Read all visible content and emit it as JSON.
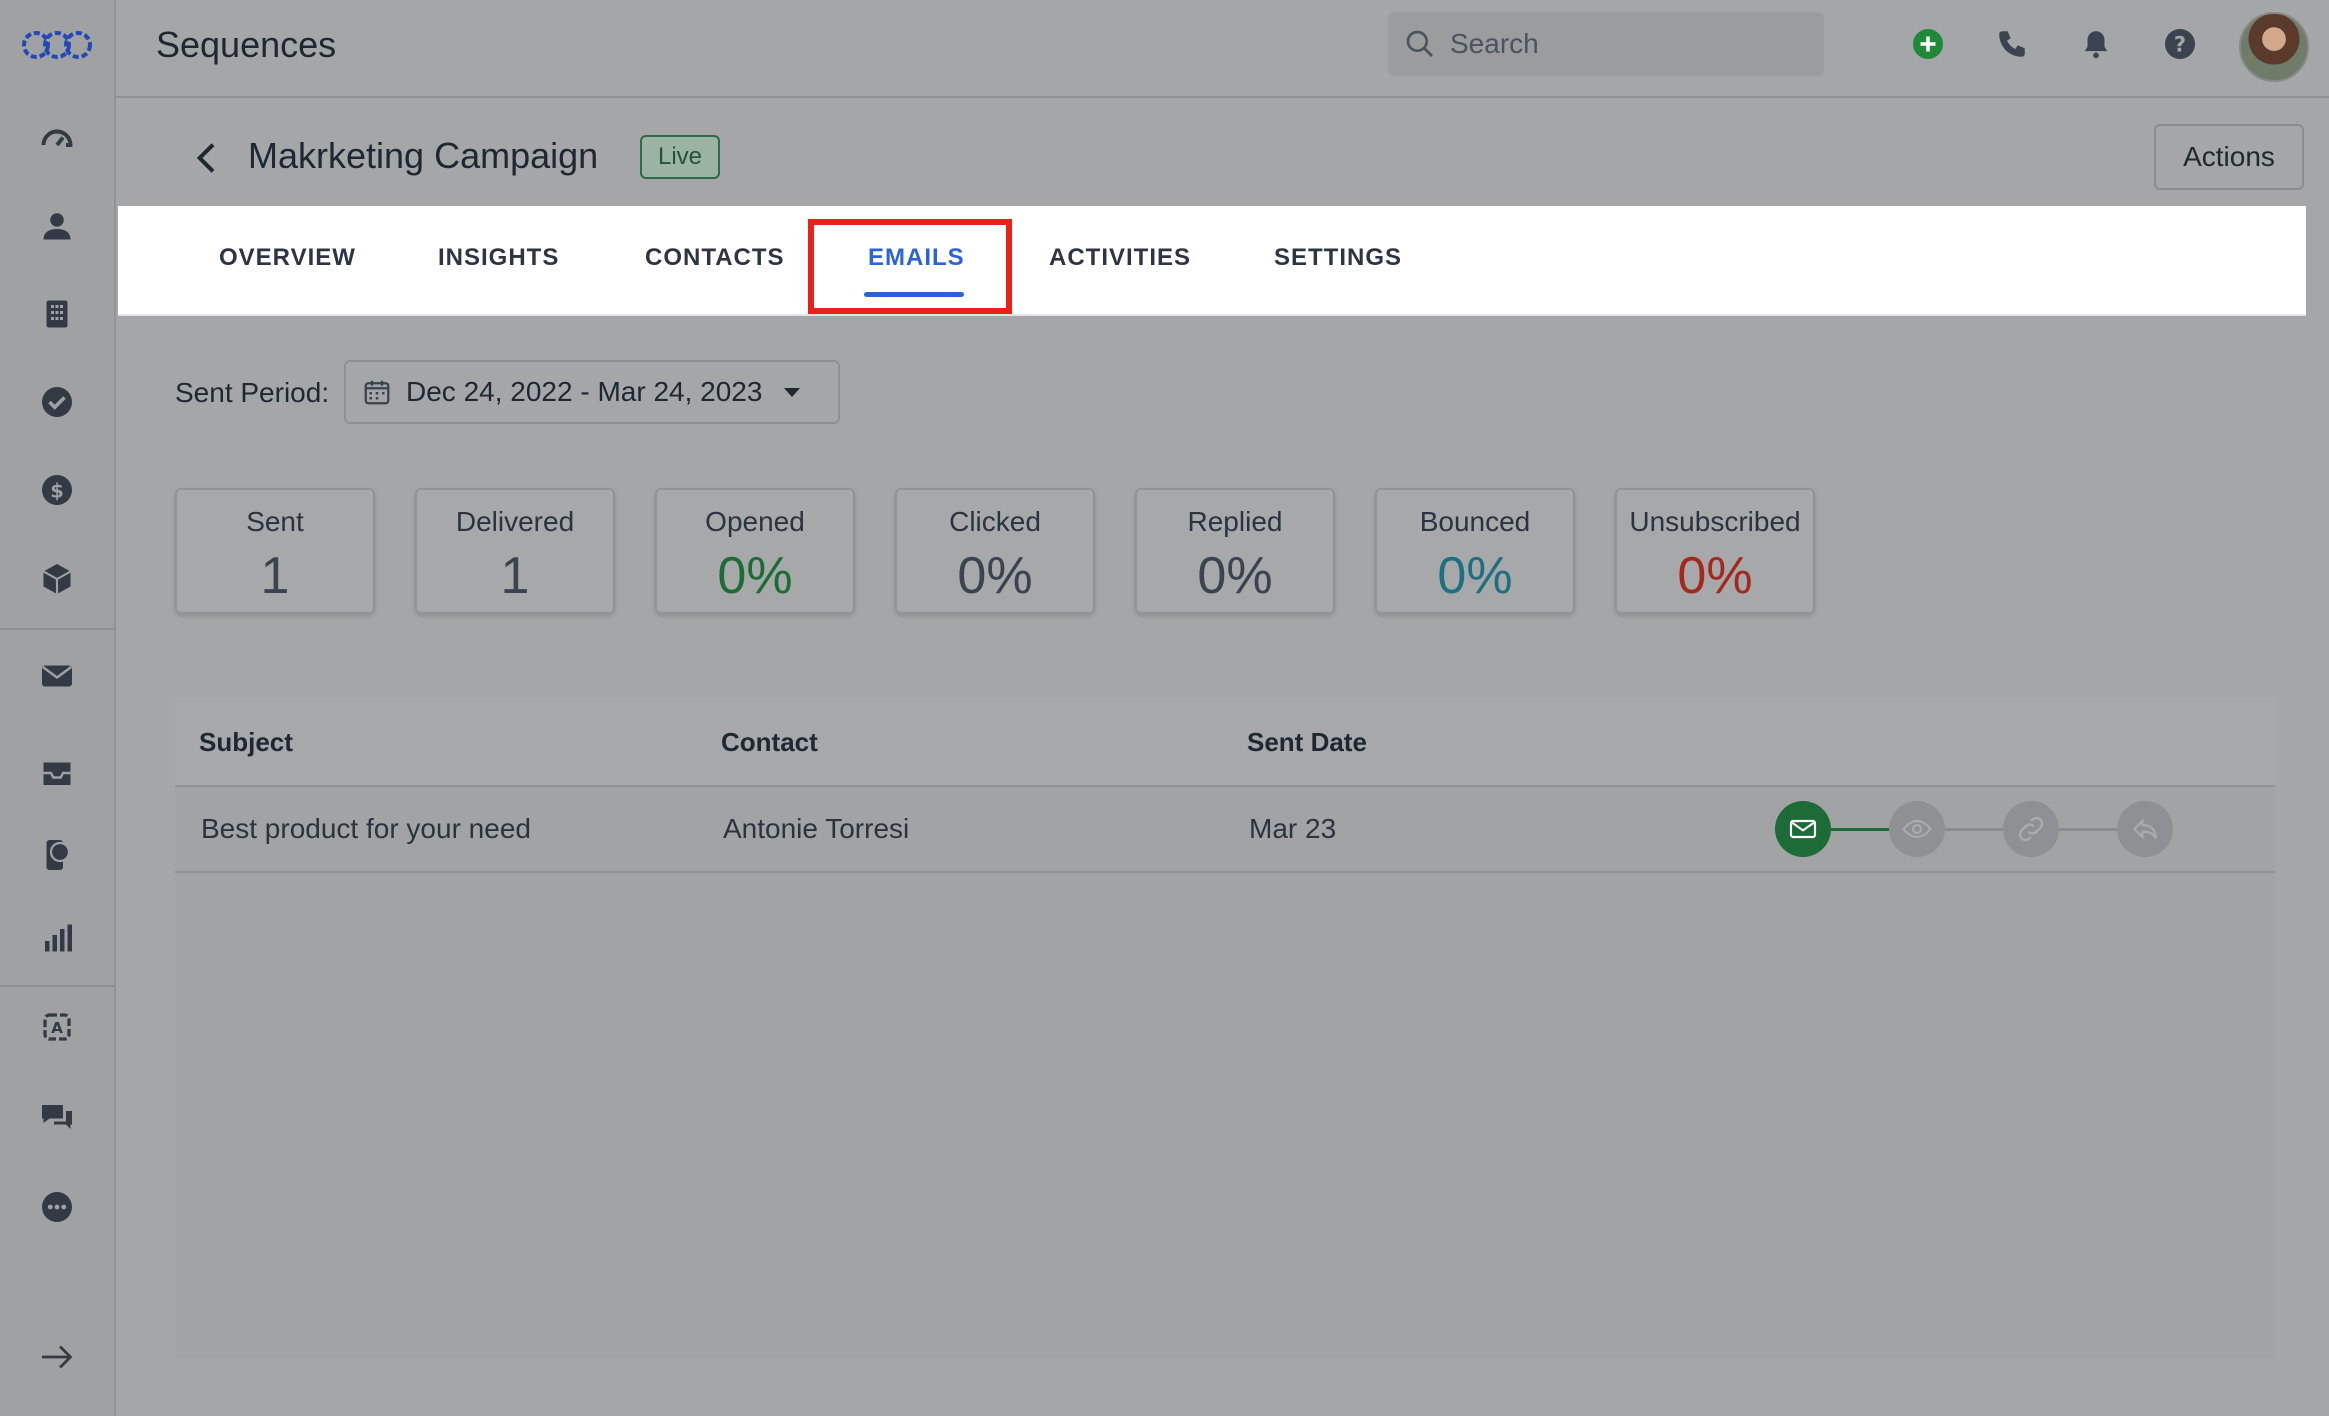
{
  "app": {
    "title": "Sequences"
  },
  "search": {
    "placeholder": "Search"
  },
  "page": {
    "title": "Makrketing Campaign",
    "status": "Live",
    "actions_label": "Actions"
  },
  "tabs": [
    {
      "label": "OVERVIEW"
    },
    {
      "label": "INSIGHTS"
    },
    {
      "label": "CONTACTS"
    },
    {
      "label": "EMAILS",
      "active": true
    },
    {
      "label": "ACTIVITIES"
    },
    {
      "label": "SETTINGS"
    }
  ],
  "filter": {
    "label": "Sent Period:",
    "value": "Dec 24, 2022 - Mar 24, 2023"
  },
  "stats": [
    {
      "label": "Sent",
      "value": "1",
      "color": "#3b4350"
    },
    {
      "label": "Delivered",
      "value": "1",
      "color": "#3b4350"
    },
    {
      "label": "Opened",
      "value": "0%",
      "color": "#1d6b36"
    },
    {
      "label": "Clicked",
      "value": "0%",
      "color": "#3b4350"
    },
    {
      "label": "Replied",
      "value": "0%",
      "color": "#3b4350"
    },
    {
      "label": "Bounced",
      "value": "0%",
      "color": "#1f6f82"
    },
    {
      "label": "Unsubscribed",
      "value": "0%",
      "color": "#a3281d"
    }
  ],
  "table": {
    "headers": {
      "subject": "Subject",
      "contact": "Contact",
      "sent_date": "Sent Date"
    },
    "rows": [
      {
        "subject": "Best product for your need",
        "contact": "Antonie Torresi",
        "sent_date": "Mar 23",
        "tracker": [
          "sent-icon",
          "opened-icon",
          "clicked-icon",
          "replied-icon"
        ]
      }
    ]
  },
  "colors": {
    "accent": "#2b63d9",
    "live_green": "#245237",
    "highlight": "#e8221b",
    "sent_green": "#1d6b36"
  }
}
